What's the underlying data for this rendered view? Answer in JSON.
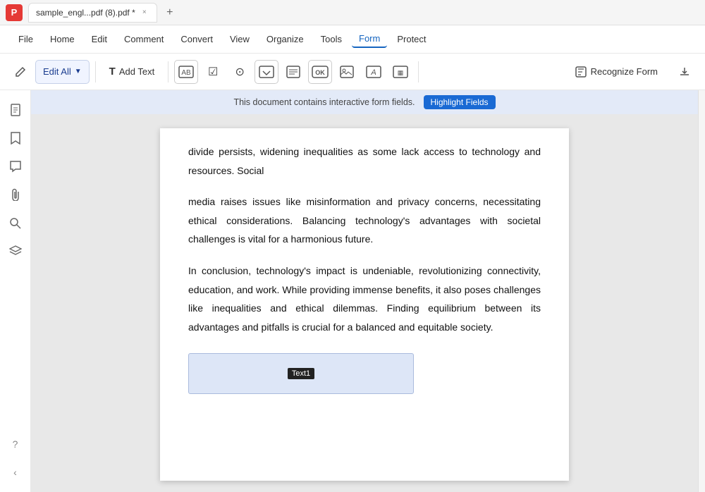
{
  "titleBar": {
    "appIcon": "P",
    "tab": {
      "label": "sample_engl...pdf (8).pdf *",
      "closeLabel": "×"
    },
    "newTabLabel": "+"
  },
  "menuBar": {
    "items": [
      {
        "id": "file",
        "label": "File"
      },
      {
        "id": "home",
        "label": "Home"
      },
      {
        "id": "edit",
        "label": "Edit"
      },
      {
        "id": "comment",
        "label": "Comment"
      },
      {
        "id": "convert",
        "label": "Convert"
      },
      {
        "id": "view",
        "label": "View"
      },
      {
        "id": "organize",
        "label": "Organize"
      },
      {
        "id": "tools",
        "label": "Tools"
      },
      {
        "id": "form",
        "label": "Form",
        "active": true
      },
      {
        "id": "protect",
        "label": "Protect"
      }
    ]
  },
  "toolbar": {
    "editAllLabel": "Edit All",
    "addTextField": "Add Text",
    "recognizeFormLabel": "Recognize Form",
    "icons": [
      {
        "id": "text-icon",
        "symbol": "T"
      },
      {
        "id": "checkbox-icon",
        "symbol": "☑"
      },
      {
        "id": "radio-icon",
        "symbol": "⊙"
      },
      {
        "id": "dropdown-icon",
        "symbol": "▼"
      },
      {
        "id": "list-icon",
        "symbol": "≡"
      },
      {
        "id": "button-icon",
        "symbol": "OK"
      },
      {
        "id": "image-icon",
        "symbol": "⬜"
      },
      {
        "id": "sign-icon",
        "symbol": "A"
      },
      {
        "id": "date-icon",
        "symbol": "▦"
      }
    ]
  },
  "sidebarIcons": [
    {
      "id": "page",
      "symbol": "⬜"
    },
    {
      "id": "bookmark",
      "symbol": "🔖"
    },
    {
      "id": "comment",
      "symbol": "💬"
    },
    {
      "id": "attach",
      "symbol": "📎"
    },
    {
      "id": "search",
      "symbol": "🔍"
    },
    {
      "id": "layers",
      "symbol": "◧"
    },
    {
      "id": "help",
      "symbol": "?"
    },
    {
      "id": "collapse",
      "symbol": "‹"
    }
  ],
  "notification": {
    "message": "This document contains interactive form fields.",
    "buttonLabel": "Highlight Fields"
  },
  "pdf": {
    "topText": "divide persists, widening inequalities as some lack access to technology and resources. Social",
    "para1": "media raises issues like misinformation and privacy concerns, necessitating ethical considerations. Balancing technology's advantages with societal challenges is vital for a harmonious future.",
    "para2": "In conclusion, technology's impact is undeniable, revolutionizing connectivity, education, and work. While providing immense benefits, it also poses challenges like inequalities and ethical dilemmas. Finding equilibrium between its advantages and pitfalls is crucial for a balanced and equitable society.",
    "textFieldLabel": "Text1"
  },
  "colors": {
    "accent": "#1565c0",
    "formActive": "#e8f0fe",
    "notificationBg": "#e3eaf8",
    "highlightBtn": "#1a6ad4",
    "textFieldBg": "#dde6f7"
  }
}
